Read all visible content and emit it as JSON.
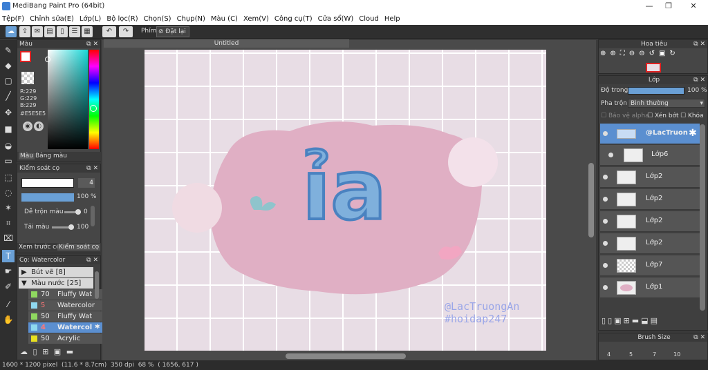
{
  "app": {
    "title": "MediBang Paint Pro (64bit)"
  },
  "menu": [
    "Tệp(F)",
    "Chỉnh sửa(E)",
    "Lớp(L)",
    "Bộ lọc(R)",
    "Chọn(S)",
    "Chụp(N)",
    "Màu (C)",
    "Xem(V)",
    "Công cụ(T)",
    "Cửa sổ(W)",
    "Cloud",
    "Help"
  ],
  "toolbar": {
    "key_label": "Phím",
    "reset_label": "Đặt lại"
  },
  "color_panel": {
    "title": "Màu",
    "r": "R:229",
    "g": "G:229",
    "b": "B:229",
    "hex": "#E5E5E5",
    "tab1": "Màu",
    "tab2": "Bảng màu",
    "primary": "#e02020",
    "secondary": "#ffffff"
  },
  "brush_control": {
    "title": "Kiểm soát cọ",
    "size": "4",
    "opacity": "100 %",
    "mix_label": "Dễ trộn màu",
    "mix_value": "0",
    "color_label": "Tải màu",
    "color_value": "100",
    "tab1": "Xem trước cọ",
    "tab2": "Kiểm soát cọ"
  },
  "brush_list": {
    "title": "Cọ: Watercolor",
    "groups": [
      "Bút vẽ [8]",
      "Màu nước [25]"
    ],
    "items": [
      {
        "size": "70",
        "name": "Fluffy Wat",
        "color": "#8fd860"
      },
      {
        "size": "5",
        "name": "Watercolor",
        "color": "#8fd8f0"
      },
      {
        "size": "50",
        "name": "Fluffy Wat",
        "color": "#8fd860"
      },
      {
        "size": "4",
        "name": "Watercol",
        "color": "#8fd8f0"
      },
      {
        "size": "50",
        "name": "Acrylic",
        "color": "#e8e020"
      }
    ]
  },
  "document": {
    "tab": "Untitled"
  },
  "artwork": {
    "word": "ỉa",
    "watermark1": "@LacTruongAn",
    "watermark2": "#hoidap247"
  },
  "navigator": {
    "title": "Hoa tiêu"
  },
  "layer_panel": {
    "title": "Lớp",
    "opacity_label": "Độ trong",
    "opacity_value": "100 %",
    "blend_label": "Pha trộn",
    "blend_value": "Bình thường",
    "alpha_label": "Bảo vệ alpha",
    "clip_label": "Xén bớt",
    "lock_label": "Khóa",
    "layers": [
      "@LacTruon",
      "Lớp6",
      "Lớp2",
      "Lớp2",
      "Lớp2",
      "Lớp2",
      "Lớp7",
      "Lớp1"
    ]
  },
  "brush_size": {
    "title": "Brush Size",
    "sizes": [
      "4",
      "5",
      "7",
      "10"
    ]
  },
  "status": {
    "size": "1600 * 1200 pixel",
    "phys": "(11.6 * 8.7cm)",
    "dpi": "350 dpi",
    "zoom": "68 %",
    "coords": "( 1656, 617 )"
  }
}
